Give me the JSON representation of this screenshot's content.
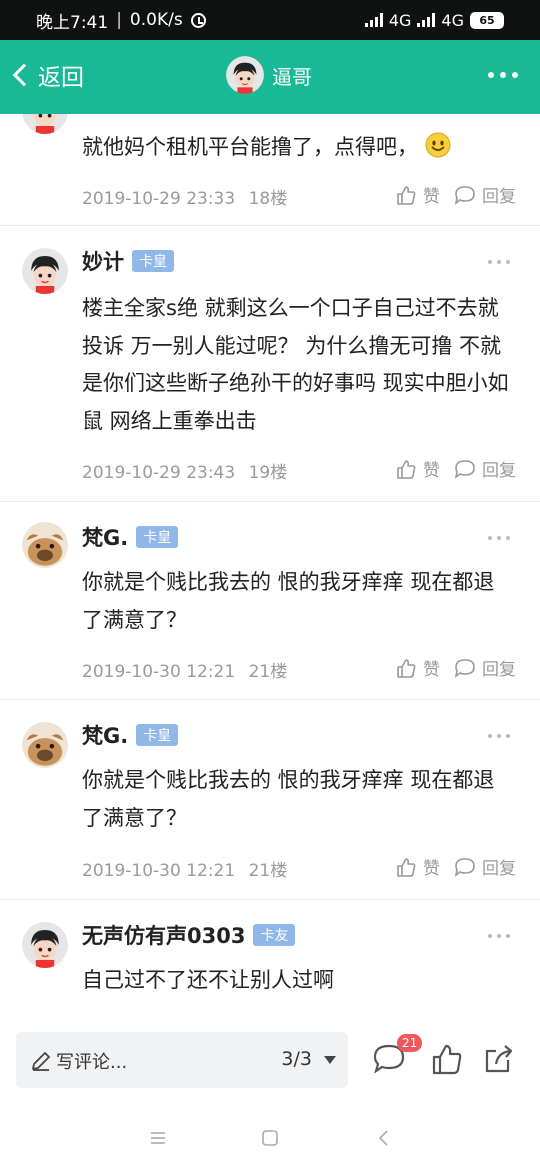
{
  "status": {
    "time": "晚上7:41",
    "speed": "0.0K/s",
    "net1": "4G",
    "net2": "4G",
    "battery": "65"
  },
  "nav": {
    "back_label": "返回",
    "title": "逼哥"
  },
  "replies": [
    {
      "text": "就他妈个租机平台能撸了，点得吧，",
      "time": "2019-10-29 23:33",
      "floor": "18楼",
      "like_label": "赞",
      "reply_label": "回复"
    },
    {
      "name": "妙计",
      "badge": "卡皇",
      "text": "楼主全家s绝  就剩这么一个口子自己过不去就投诉  万一别人能过呢？ 为什么撸无可撸  不就是你们这些断子绝孙干的好事吗   现实中胆小如鼠  网络上重拳出击",
      "time": "2019-10-29 23:43",
      "floor": "19楼",
      "like_label": "赞",
      "reply_label": "回复"
    },
    {
      "name": "梵G.",
      "badge": "卡皇",
      "text": "你就是个贱比我去的 恨的我牙痒痒 现在都退了满意了？",
      "time": "2019-10-30 12:21",
      "floor": "21楼",
      "like_label": "赞",
      "reply_label": "回复"
    },
    {
      "name": "梵G.",
      "badge": "卡皇",
      "text": "你就是个贱比我去的 恨的我牙痒痒 现在都退了满意了？",
      "time": "2019-10-30 12:21",
      "floor": "21楼",
      "like_label": "赞",
      "reply_label": "回复"
    },
    {
      "name": "无声仿有声0303",
      "badge": "卡友",
      "text": "自己过不了还不让别人过啊"
    }
  ],
  "bottom": {
    "comment_placeholder": "写评论...",
    "pager": "3/3",
    "comment_count": "21"
  },
  "colors": {
    "nav_bg": "#19b997",
    "badge_bg": "#8fb8e8",
    "count_badge": "#f0585d"
  }
}
